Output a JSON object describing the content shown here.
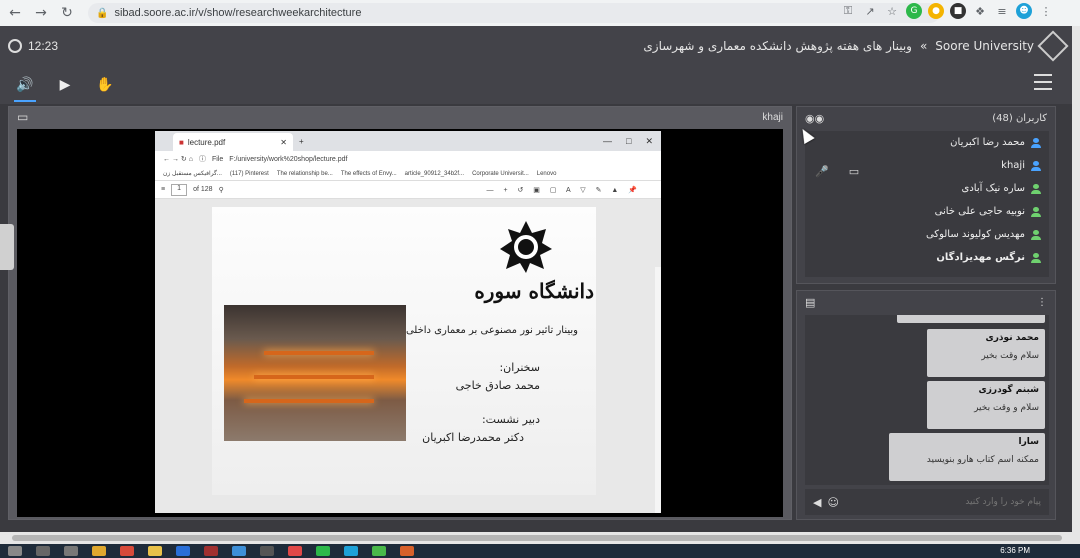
{
  "browser": {
    "url": "sibad.soore.ac.ir/v/show/researchweekarchitecture"
  },
  "header": {
    "time": "12:23",
    "breadcrumb_root": "Soore University",
    "separator": "»",
    "title": "وبینار های هفته پژوهش دانشکده معماری و شهرسازی"
  },
  "presentation": {
    "presenter": "khaji",
    "window": {
      "tab_title": "lecture.pdf",
      "file_label": "File",
      "url": "F:/university/work%20shop/lecture.pdf",
      "bookmarks": [
        "گرافیکس مستقبل زن...",
        "(117) Pinterest",
        "The relationship be...",
        "The effects of Envy...",
        "article_90912_34b2f...",
        "Corporate Universit...",
        "Lenovo"
      ],
      "page_num": "1",
      "page_total": "of 128"
    },
    "slide": {
      "university_name": "دانشگاه سوره",
      "webinar_title": "وبینار تاثیر نور مصنوعی بر معماری داخلی",
      "speakers_label": "سخنران:",
      "speaker_name": "محمد صادق خاجی",
      "secretary_label": "دبیر نشست:",
      "secretary_name": "دکتر محمدرضا اکبریان"
    }
  },
  "users": {
    "title": "کاربران (48)",
    "list": [
      {
        "name": "محمد رضا اکبریان",
        "color": "#4aa3ff"
      },
      {
        "name": "khaji",
        "color": "#4aa3ff"
      },
      {
        "name": "ساره نیک آبادی",
        "color": "#6fd16f"
      },
      {
        "name": "نوبیه حاجی علی خانی",
        "color": "#6fd16f"
      },
      {
        "name": "مهدیس کولیوند سالوکی",
        "color": "#6fd16f"
      },
      {
        "name": "نرگس مهدیزادگان",
        "color": "#6fd16f"
      }
    ]
  },
  "chat": {
    "messages": [
      {
        "name": "محمد نوذری",
        "text": "سلام وقت بخیر"
      },
      {
        "name": "شبنم گودرزی",
        "text": "سلام و وقت بخیر"
      },
      {
        "name": "سارا",
        "text": "ممکنه اسم کتاب هارو بنویسید"
      }
    ],
    "input_placeholder": "پیام خود را وارد کنید"
  },
  "taskbar": {
    "time": "6:36 PM"
  },
  "colors": {
    "accent": "#4aa3ff",
    "online": "#6fd16f",
    "panel": "#434349",
    "background": "#3a3a3f"
  }
}
